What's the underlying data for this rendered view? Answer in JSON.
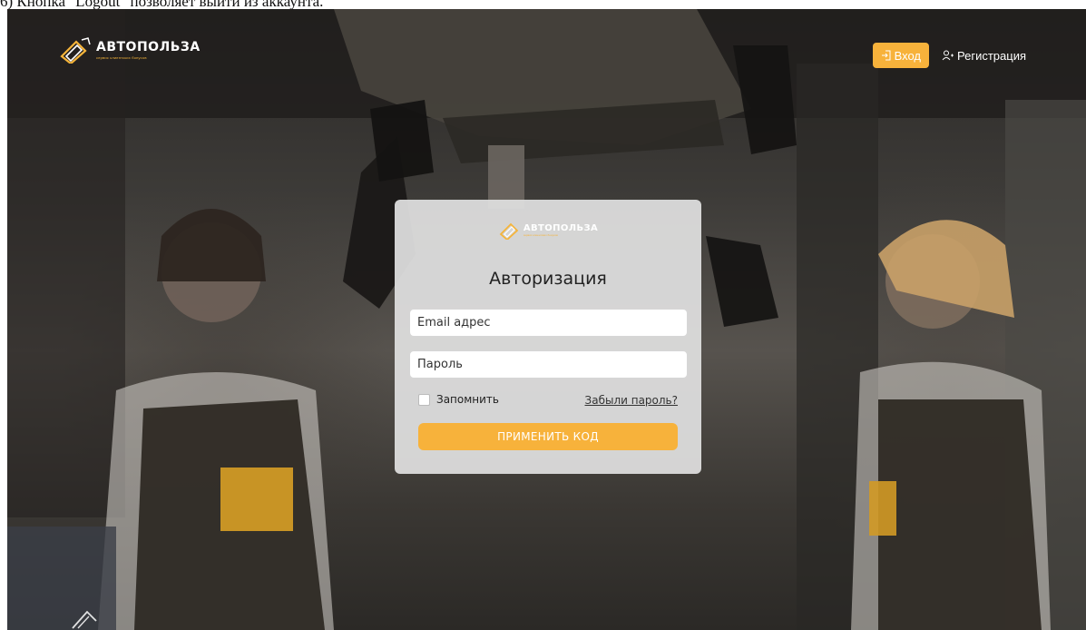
{
  "document_caption": "6) Кнопка \"Logout\" позволяет выйти из аккаунта.",
  "header": {
    "logo_title": "АВТОПОЛЬЗА",
    "logo_subtitle": "сервис клиентских бонусов",
    "login_label": "Вход",
    "register_label": "Регистрация"
  },
  "auth_card": {
    "logo_title": "АВТОПОЛЬЗА",
    "logo_subtitle": "сервис клиентских бонусов",
    "title": "Авторизация",
    "email_placeholder": "Email адрес",
    "password_placeholder": "Пароль",
    "remember_label": "Запомнить",
    "forgot_label": "Забыли пароль?",
    "submit_label": "ПРИМЕНИТЬ КОД"
  },
  "icons": {
    "login": "login-icon",
    "register": "user-plus-icon",
    "logo": "wrench-card-icon"
  },
  "colors": {
    "accent": "#f7b23b",
    "card_bg": "#dedede",
    "text_dark": "#222222"
  }
}
